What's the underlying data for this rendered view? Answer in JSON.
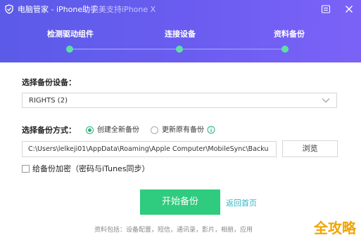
{
  "titlebar": {
    "app_name": "电脑管家 - iPhone助手",
    "promo": "完美支持iPhone X",
    "icons": {
      "app": "shield-icon",
      "menu": "menu-icon",
      "close": "close-icon"
    }
  },
  "steps": [
    {
      "label": "检测驱动组件",
      "state": "done"
    },
    {
      "label": "连接设备",
      "state": "done"
    },
    {
      "label": "资料备份",
      "state": "active"
    }
  ],
  "device_select": {
    "label": "选择备份设备：",
    "value": "RIGHTS (2)"
  },
  "backup_mode": {
    "label": "选择备份方式：",
    "options": [
      {
        "label": "创建全新备份",
        "selected": true
      },
      {
        "label": "更新原有备份",
        "selected": false
      }
    ]
  },
  "path": {
    "value": "C:\\Users\\lelkeji01\\AppData\\Roaming\\Apple Computer\\MobileSync\\Backu",
    "browse_label": "浏览"
  },
  "encrypt": {
    "label": "给备份加密（密码与iTunes同步）",
    "checked": false
  },
  "actions": {
    "start_label": "开始备份",
    "back_label": "返回首页"
  },
  "footnote": "资料包括：设备配置，短信，通讯录，影片，相册，应用",
  "watermark": "全攻略",
  "colors": {
    "header": "#6a5cf0",
    "accent_green": "#2fcb7e",
    "step_dot": "#5ce0a4",
    "link": "#2fb7c8"
  }
}
